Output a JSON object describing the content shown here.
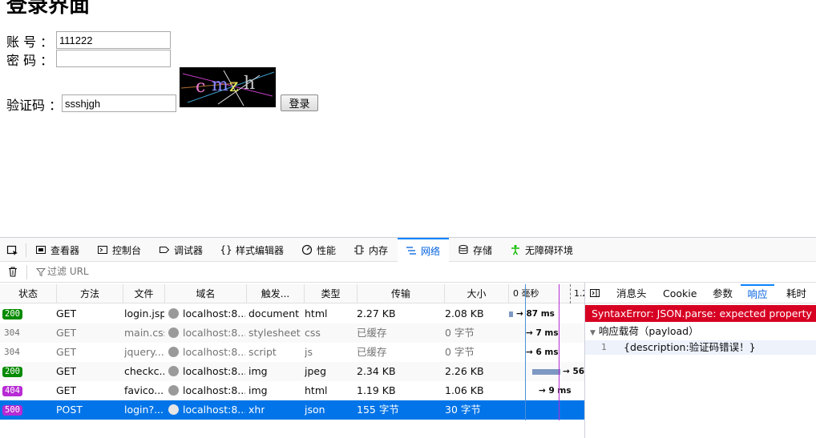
{
  "login": {
    "title": "登录界面",
    "account_label": "账 号 ：",
    "account_value": "111222",
    "password_label": "密 码 ：",
    "password_value": "",
    "captcha_label": "验证码 ：",
    "captcha_value": "ssshjgh",
    "captcha_text": "cmzh",
    "login_button": "登录"
  },
  "devtools": {
    "tabs": [
      {
        "label": "查看器",
        "icon": "inspector-icon"
      },
      {
        "label": "控制台",
        "icon": "console-icon"
      },
      {
        "label": "调试器",
        "icon": "debugger-icon"
      },
      {
        "label": "样式编辑器",
        "icon": "style-editor-icon"
      },
      {
        "label": "性能",
        "icon": "performance-icon"
      },
      {
        "label": "内存",
        "icon": "memory-icon"
      },
      {
        "label": "网络",
        "icon": "network-icon"
      },
      {
        "label": "存储",
        "icon": "storage-icon"
      },
      {
        "label": "无障碍环境",
        "icon": "accessibility-icon"
      }
    ],
    "active_tab": "网络",
    "filter_placeholder": "过滤 URL",
    "columns": [
      "状态",
      "方法",
      "文件",
      "域名",
      "触发...",
      "类型",
      "传输",
      "大小"
    ],
    "waterfall_labels": [
      "0 毫秒",
      "1.2"
    ],
    "requests": [
      {
        "status": "200",
        "method": "GET",
        "file": "login.jsp",
        "domain": "localhost:8...",
        "cause": "document",
        "type": "html",
        "transferred": "2.27 KB",
        "size": "2.08 KB",
        "timing": "→ 87 ms",
        "duration_ms": 87
      },
      {
        "status": "304",
        "method": "GET",
        "file": "main.css",
        "domain": "localhost:8...",
        "cause": "stylesheet",
        "type": "css",
        "transferred": "已缓存",
        "size": "0 字节",
        "timing": "→ 7 ms",
        "duration_ms": 7
      },
      {
        "status": "304",
        "method": "GET",
        "file": "jquery....",
        "domain": "localhost:8...",
        "cause": "script",
        "type": "js",
        "transferred": "已缓存",
        "size": "0 字节",
        "timing": "→ 6 ms",
        "duration_ms": 6
      },
      {
        "status": "200",
        "method": "GET",
        "file": "checkc...",
        "domain": "localhost:8...",
        "cause": "img",
        "type": "jpeg",
        "transferred": "2.34 KB",
        "size": "2.26 KB",
        "timing": "→ 56",
        "duration_ms": 56
      },
      {
        "status": "404",
        "method": "GET",
        "file": "favico...",
        "domain": "localhost:8...",
        "cause": "img",
        "type": "html",
        "transferred": "1.19 KB",
        "size": "1.06 KB",
        "timing": "→ 9 ms",
        "duration_ms": 9
      },
      {
        "status": "500",
        "method": "POST",
        "file": "login?...",
        "domain": "localhost:8...",
        "cause": "xhr",
        "type": "json",
        "transferred": "155 字节",
        "size": "30 字节",
        "timing": "",
        "duration_ms": null
      }
    ],
    "status_colors": {
      "200": "#058b00",
      "404": "#b72bd4",
      "500": "#b72bd4"
    },
    "selected_request": 5,
    "side_tabs": [
      "消息头",
      "Cookie",
      "参数",
      "响应",
      "耗时"
    ],
    "active_side_tab": "响应",
    "error_message": "SyntaxError: JSON.parse: expected property name",
    "payload_label": "响应载荷（payload）",
    "response_line_number": "1",
    "response_body": "{description:验证码错误！}"
  }
}
